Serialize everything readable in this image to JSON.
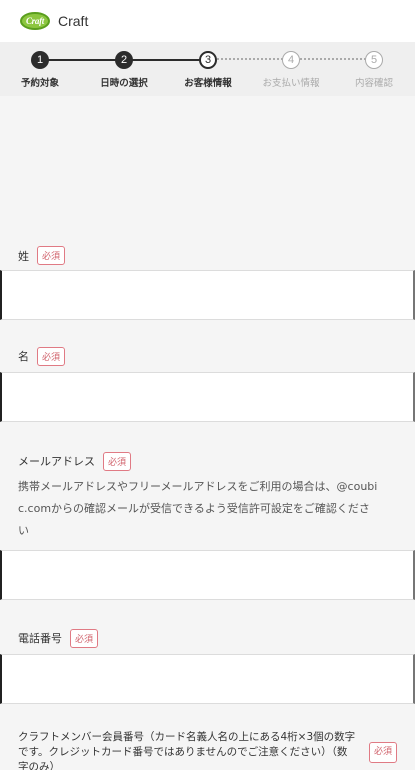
{
  "header": {
    "brand": "Craft",
    "logo_text": "Craft"
  },
  "stepper": {
    "steps": [
      {
        "num": "1",
        "label": "予約対象"
      },
      {
        "num": "2",
        "label": "日時の選択"
      },
      {
        "num": "3",
        "label": "お客様情報"
      },
      {
        "num": "4",
        "label": "お支払い情報"
      },
      {
        "num": "5",
        "label": "内容確認"
      }
    ],
    "current_step": 3
  },
  "form": {
    "required_badge": "必須",
    "last_name": {
      "label": "姓",
      "value": ""
    },
    "first_name": {
      "label": "名",
      "value": ""
    },
    "email": {
      "label": "メールアドレス",
      "note_line1": "携帯メールアドレスやフリーメールアドレスをご利用の場合は、@coubi",
      "note_line2": "c.comからの確認メールが受信できるよう受信許可設定をご確認くださ",
      "note_line3": "い",
      "value": ""
    },
    "phone": {
      "label": "電話番号",
      "value": ""
    },
    "member": {
      "label_line1": "クラフトメンバー会員番号（カード名義人名の上にある4桁×3個の数字",
      "label_line2": "です。クレジットカード番号ではありませんのでご注意ください）（数",
      "label_line3": "字のみ）"
    }
  }
}
